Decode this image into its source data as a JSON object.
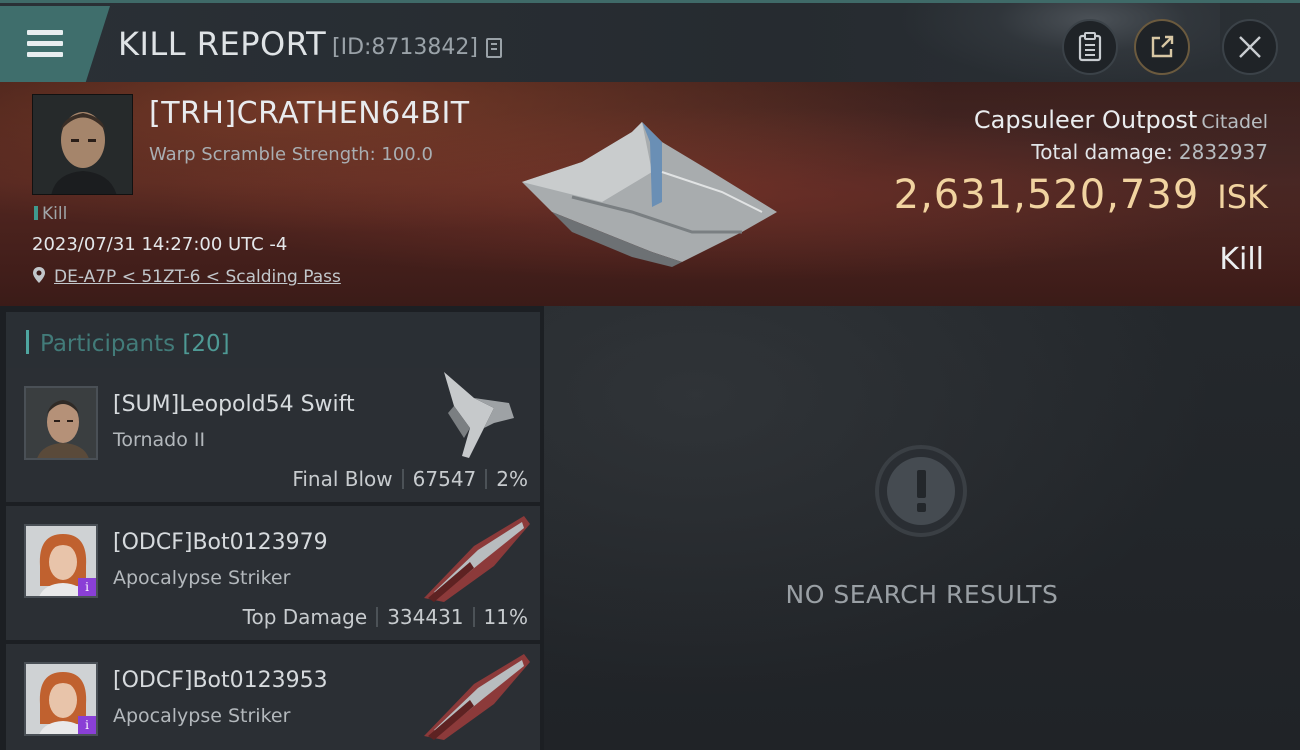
{
  "header": {
    "title": "KILL REPORT",
    "report_id": "[ID:8713842]"
  },
  "victim": {
    "pilot_name": "[TRH]CRATHEN64BIT",
    "warp_scramble": "Warp Scramble Strength: 100.0",
    "result_tag": "Kill",
    "timestamp": "2023/07/31 14:27:00 UTC -4",
    "location": "DE-A7P < 51ZT-6 < Scalding Pass",
    "structure_name": "Capsuleer Outpost",
    "structure_class": "Citadel",
    "total_damage_label": "Total damage:",
    "total_damage_value": "2832937",
    "isk_value": "2,631,520,739",
    "isk_unit": "ISK",
    "kill_label": "Kill"
  },
  "participants": {
    "label": "Participants",
    "count": "[20]",
    "rows": [
      {
        "name": "[SUM]Leopold54 Swift",
        "ship": "Tornado II",
        "role": "Final Blow",
        "damage": "67547",
        "percent": "2%"
      },
      {
        "name": "[ODCF]Bot0123979",
        "ship": "Apocalypse Striker",
        "role": "Top Damage",
        "damage": "334431",
        "percent": "11%"
      },
      {
        "name": "[ODCF]Bot0123953",
        "ship": "Apocalypse Striker"
      }
    ]
  },
  "results": {
    "empty_text": "NO SEARCH RESULTS"
  },
  "colors": {
    "accent_teal": "#3f6e6c",
    "isk_gold": "#f1d3a0",
    "badge_purple": "#8a3fd6"
  },
  "icons": {
    "menu": "hamburger-menu-icon",
    "copy": "copy-icon",
    "clipboard": "clipboard-icon",
    "share": "share-icon",
    "close": "close-icon",
    "location": "location-pin-icon",
    "empty": "exclamation-icon"
  }
}
